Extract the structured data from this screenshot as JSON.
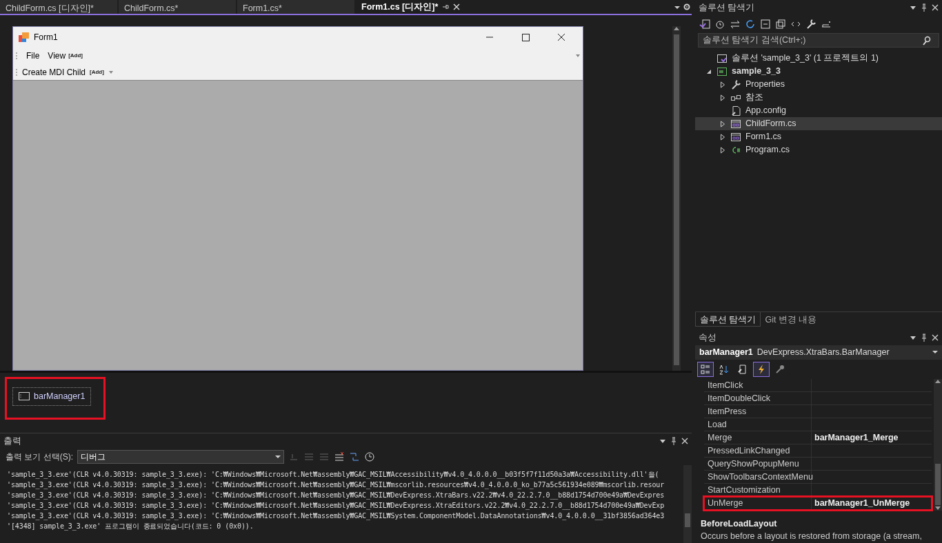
{
  "document_tabs": [
    {
      "label": "ChildForm.cs [디자인]*",
      "selected": false
    },
    {
      "label": "ChildForm.cs*",
      "selected": false
    },
    {
      "label": "Form1.cs*",
      "selected": false
    },
    {
      "label": "Form1.cs [디자인]*",
      "selected": true
    }
  ],
  "form_window": {
    "title": "Form1",
    "menu": [
      "File",
      "View"
    ],
    "menu_add": "[Add]",
    "toolbar": [
      "Create MDI Child"
    ],
    "toolbar_add": "[Add]"
  },
  "component_tray": [
    {
      "label": "barManager1",
      "highlighted": true
    }
  ],
  "output": {
    "title": "출력",
    "source_label": "출력 보기 선택(S):",
    "source": "디버그",
    "lines": [
      "'sample_3_3.exe'(CLR v4.0.30319: sample_3_3.exe): 'C:₩Windows₩Microsoft.Net₩assembly₩GAC_MSIL₩Accessibility₩v4.0_4.0.0.0__b03f5f7f11d50a3a₩Accessibility.dll'을(",
      "'sample_3_3.exe'(CLR v4.0.30319: sample_3_3.exe): 'C:₩Windows₩Microsoft.Net₩assembly₩GAC_MSIL₩mscorlib.resources₩v4.0_4.0.0.0_ko_b77a5c561934e089₩mscorlib.resour",
      "'sample_3_3.exe'(CLR v4.0.30319: sample_3_3.exe): 'C:₩Windows₩Microsoft.Net₩assembly₩GAC_MSIL₩DevExpress.XtraBars.v22.2₩v4.0_22.2.7.0__b88d1754d700e49a₩DevExpres",
      "'sample_3_3.exe'(CLR v4.0.30319: sample_3_3.exe): 'C:₩Windows₩Microsoft.Net₩assembly₩GAC_MSIL₩DevExpress.XtraEditors.v22.2₩v4.0_22.2.7.0__b88d1754d700e49a₩DevExp",
      "'sample_3_3.exe'(CLR v4.0.30319: sample_3_3.exe): 'C:₩Windows₩Microsoft.Net₩assembly₩GAC_MSIL₩System.ComponentModel.DataAnnotations₩v4.0_4.0.0.0__31bf3856ad364e3",
      "'[4348] sample_3_3.exe' 프로그램이 종료되었습니다(코드: 0 (0x0))."
    ]
  },
  "solution_explorer": {
    "title": "솔루션 탐색기",
    "search_placeholder": "솔루션 탐색기 검색(Ctrl+;)",
    "tree": [
      {
        "label": "솔루션 'sample_3_3'  (1 프로젝트의 1)",
        "kind": "solution",
        "selected": false
      },
      {
        "label": "sample_3_3",
        "kind": "project",
        "expanded": true,
        "selected": false,
        "children": [
          {
            "label": "Properties",
            "kind": "properties",
            "expanded": false,
            "selected": false
          },
          {
            "label": "참조",
            "kind": "references",
            "expanded": false,
            "selected": false
          },
          {
            "label": "App.config",
            "kind": "config",
            "selected": false
          },
          {
            "label": "ChildForm.cs",
            "kind": "form",
            "expanded": false,
            "selected": true
          },
          {
            "label": "Form1.cs",
            "kind": "form",
            "expanded": false,
            "selected": false
          },
          {
            "label": "Program.cs",
            "kind": "csharp",
            "expanded": false,
            "selected": false
          }
        ]
      }
    ]
  },
  "panel_tabs": [
    {
      "label": "솔루션 탐색기",
      "selected": true
    },
    {
      "label": "Git 변경 내용",
      "selected": false
    }
  ],
  "properties": {
    "title": "속성",
    "object_name": "barManager1",
    "object_type": "DevExpress.XtraBars.BarManager",
    "toolbar": [
      {
        "kind": "categorized",
        "selected": true
      },
      {
        "kind": "alphabetical",
        "selected": false
      },
      {
        "kind": "properties",
        "selected": false
      },
      {
        "kind": "events",
        "selected": true
      },
      {
        "kind": "pages",
        "selected": false
      }
    ],
    "rows": [
      {
        "name": "ItemClick",
        "highlighted": false
      },
      {
        "name": "ItemDoubleClick",
        "highlighted": false
      },
      {
        "name": "ItemPress",
        "highlighted": false
      },
      {
        "name": "Load",
        "highlighted": false
      },
      {
        "name": "Merge",
        "value": "barManager1_Merge",
        "highlighted": false
      },
      {
        "name": "PressedLinkChanged",
        "highlighted": false
      },
      {
        "name": "QueryShowPopupMenu",
        "highlighted": false
      },
      {
        "name": "ShowToolbarsContextMenu",
        "highlighted": false
      },
      {
        "name": "StartCustomization",
        "highlighted": false
      },
      {
        "name": "UnMerge",
        "value": "barManager1_UnMerge",
        "highlighted": true
      }
    ],
    "description_title": "BeforeLoadLayout",
    "description": "Occurs before a layout is restored from storage (a stream,"
  }
}
